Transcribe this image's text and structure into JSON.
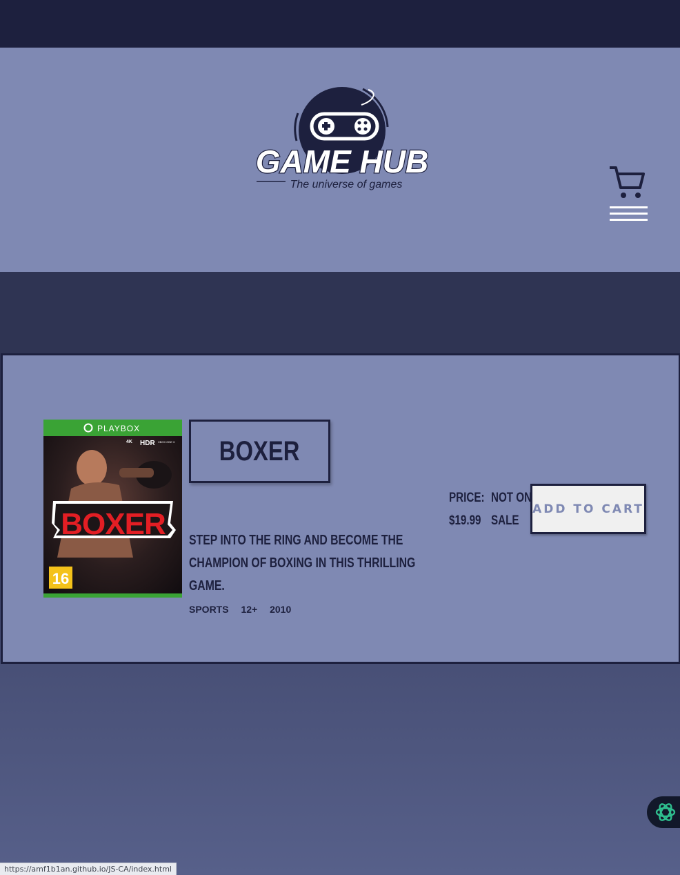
{
  "header": {
    "logo": {
      "brand": "GAME HUB",
      "tagline": "The universe of games"
    },
    "icons": [
      "cart-icon",
      "hamburger-menu-icon"
    ]
  },
  "product": {
    "title": "BOXER",
    "cover": {
      "platform": "PLAYBOX",
      "badges": [
        "4K ULTRA HD",
        "HDR",
        "XBOX ONE X ENHANCED"
      ],
      "title": "BOXER",
      "age_rating": "16"
    },
    "description": "Step into the ring and become the champion of boxing in this thrilling game.",
    "price_label": "Price:",
    "price": "$19.99",
    "sale_line1": "Not on",
    "sale_line2": "Sale",
    "add_to_cart": "Add to cart",
    "meta": {
      "genre": "Sports",
      "age": "12+",
      "year": "2010"
    }
  },
  "assistant_icon": "openai-logo-icon",
  "status_url": "https://amf1b1an.github.io/JS-CA/index.html",
  "colors": {
    "dark_navy": "#1d203e",
    "periwinkle": "#7f89b3",
    "band": "#2f3453",
    "button_bg": "#f0f0f0",
    "cover_green": "#3aa335",
    "cover_red": "#e31e24"
  }
}
